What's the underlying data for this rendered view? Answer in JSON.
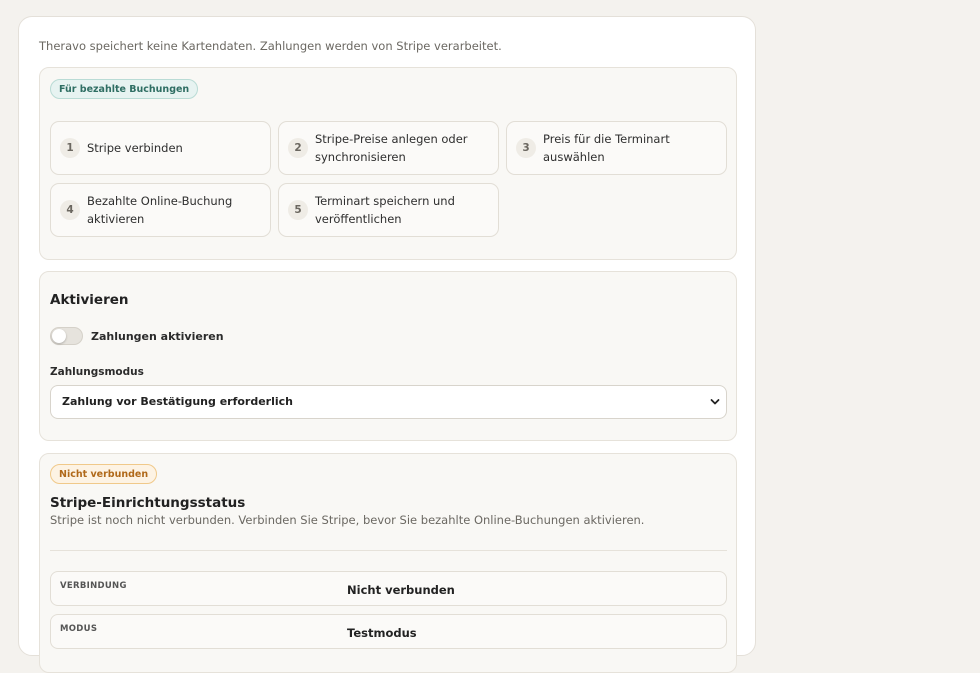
{
  "intro": "Theravo speichert keine Kartendaten. Zahlungen werden von Stripe verarbeitet.",
  "steps_panel": {
    "badge": "Für bezahlte Buchungen",
    "steps": [
      {
        "num": "1",
        "label": "Stripe verbinden"
      },
      {
        "num": "2",
        "label": "Stripe-Preise anlegen oder synchronisieren"
      },
      {
        "num": "3",
        "label": "Preis für die Terminart auswählen"
      },
      {
        "num": "4",
        "label": "Bezahlte Online-Buchung aktivieren"
      },
      {
        "num": "5",
        "label": "Terminart speichern und veröffentlichen"
      }
    ]
  },
  "activate_panel": {
    "title": "Aktivieren",
    "toggle_label": "Zahlungen aktivieren",
    "toggle_on": false,
    "mode_label": "Zahlungsmodus",
    "mode_value": "Zahlung vor Bestätigung erforderlich"
  },
  "status_panel": {
    "badge": "Nicht verbunden",
    "title": "Stripe-Einrichtungsstatus",
    "description": "Stripe ist noch nicht verbunden. Verbinden Sie Stripe, bevor Sie bezahlte Online-Buchungen aktivieren.",
    "rows": [
      {
        "key": "VERBINDUNG",
        "value": "Nicht verbunden"
      },
      {
        "key": "MODUS",
        "value": "Testmodus"
      }
    ]
  },
  "colors": {
    "accent_green": "#2f6e63",
    "warning_orange": "#b0691a",
    "background": "#f4f2ee"
  }
}
